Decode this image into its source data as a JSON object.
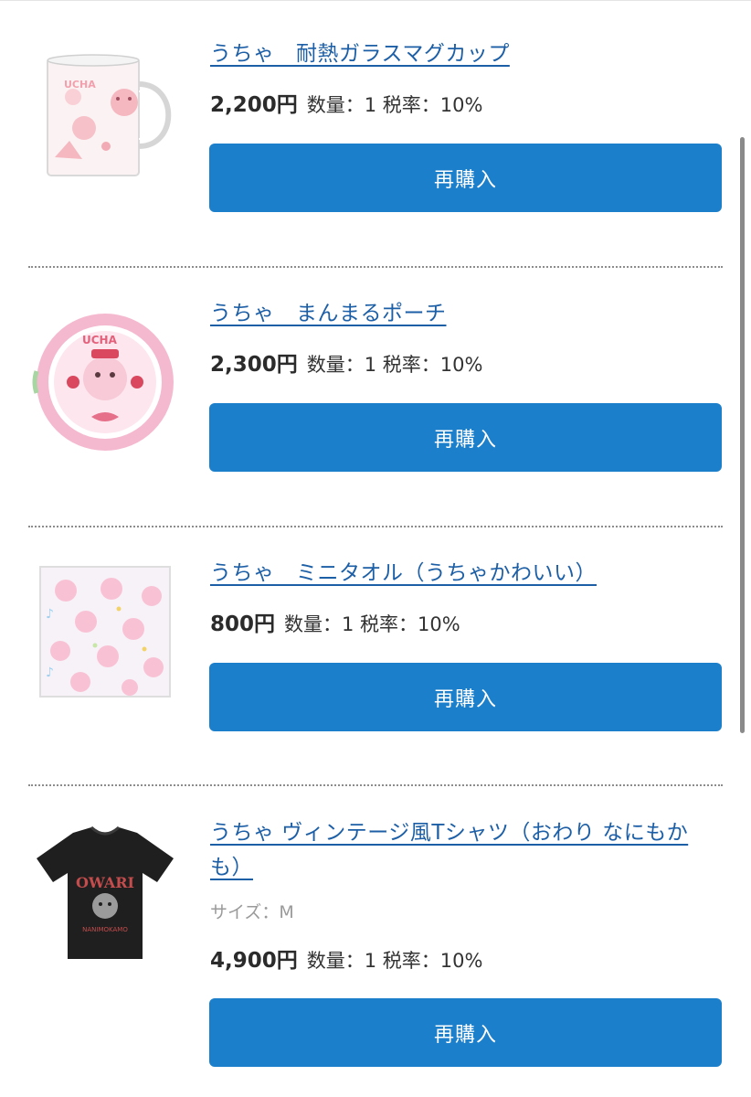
{
  "items": [
    {
      "title": "うちゃ　耐熱ガラスマグカップ",
      "price": "2,200円",
      "meta": "数量：1 税率：10%",
      "rebuy_label": "再購入",
      "image": "glass-mug-photo"
    },
    {
      "title": "うちゃ　まんまるポーチ",
      "price": "2,300円",
      "meta": "数量：1 税率：10%",
      "rebuy_label": "再購入",
      "image": "round-pouch-photo"
    },
    {
      "title": "うちゃ　ミニタオル（うちゃかわいい）",
      "price": "800円",
      "meta": "数量：1 税率：10%",
      "rebuy_label": "再購入",
      "image": "mini-towel-photo"
    },
    {
      "title_line1": "うちゃ ヴィンテージ風Tシャツ（おわり なにもか",
      "title_line2": "も）",
      "size": "サイズ：M",
      "price": "4,900円",
      "meta": "数量：1 税率：10%",
      "rebuy_label": "再購入",
      "image": "tshirt-photo",
      "shirt_print_text": [
        "OWARI",
        "NANIMOKAMO"
      ]
    }
  ],
  "colors": {
    "link": "#1d5fa6",
    "button": "#1b7fcb",
    "divider": "#8c8c8c"
  }
}
